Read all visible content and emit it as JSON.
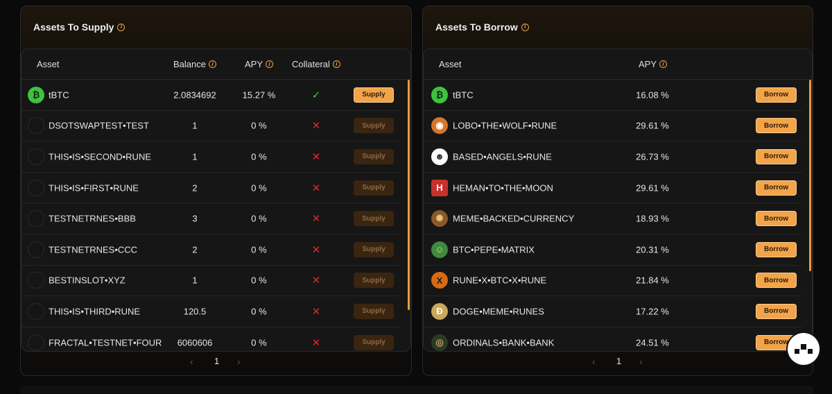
{
  "supply": {
    "title": "Assets To Supply",
    "headers": {
      "asset": "Asset",
      "balance": "Balance",
      "apy": "APY",
      "collateral": "Collateral"
    },
    "rows": [
      {
        "icon": "btc",
        "name": "tBTC",
        "balance": "2.0834692",
        "apy": "15.27 %",
        "collateral": "✓",
        "collateral_ok": true,
        "button": "Supply",
        "active": true
      },
      {
        "icon": "empty",
        "name": "DSOTSWAPTEST•TEST",
        "balance": "1",
        "apy": "0 %",
        "collateral": "✕",
        "collateral_ok": false,
        "button": "Supply",
        "active": false
      },
      {
        "icon": "empty",
        "name": "THIS•IS•SECOND•RUNE",
        "balance": "1",
        "apy": "0 %",
        "collateral": "✕",
        "collateral_ok": false,
        "button": "Supply",
        "active": false
      },
      {
        "icon": "empty",
        "name": "THIS•IS•FIRST•RUNE",
        "balance": "2",
        "apy": "0 %",
        "collateral": "✕",
        "collateral_ok": false,
        "button": "Supply",
        "active": false
      },
      {
        "icon": "empty",
        "name": "TESTNETRNES•BBB",
        "balance": "3",
        "apy": "0 %",
        "collateral": "✕",
        "collateral_ok": false,
        "button": "Supply",
        "active": false
      },
      {
        "icon": "empty",
        "name": "TESTNETRNES•CCC",
        "balance": "2",
        "apy": "0 %",
        "collateral": "✕",
        "collateral_ok": false,
        "button": "Supply",
        "active": false
      },
      {
        "icon": "empty",
        "name": "BESTINSLOT•XYZ",
        "balance": "1",
        "apy": "0 %",
        "collateral": "✕",
        "collateral_ok": false,
        "button": "Supply",
        "active": false
      },
      {
        "icon": "empty",
        "name": "THIS•IS•THIRD•RUNE",
        "balance": "120.5",
        "apy": "0 %",
        "collateral": "✕",
        "collateral_ok": false,
        "button": "Supply",
        "active": false
      },
      {
        "icon": "empty",
        "name": "FRACTAL•TESTNET•FOUR",
        "balance": "6060606",
        "apy": "0 %",
        "collateral": "✕",
        "collateral_ok": false,
        "button": "Supply",
        "active": false
      }
    ],
    "pager": {
      "prev": "‹",
      "page": "1",
      "next": "›"
    }
  },
  "borrow": {
    "title": "Assets To Borrow",
    "headers": {
      "asset": "Asset",
      "apy": "APY"
    },
    "rows": [
      {
        "icon": "btc",
        "glyph": "₿",
        "name": "tBTC",
        "apy": "16.08 %",
        "button": "Borrow"
      },
      {
        "icon": "s1",
        "glyph": "◉",
        "name": "LOBO•THE•WOLF•RUNE",
        "apy": "29.61 %",
        "button": "Borrow"
      },
      {
        "icon": "s2",
        "glyph": "☻",
        "name": "BASED•ANGELS•RUNE",
        "apy": "26.73 %",
        "button": "Borrow"
      },
      {
        "icon": "s3",
        "glyph": "H",
        "name": "HEMAN•TO•THE•MOON",
        "apy": "29.61 %",
        "button": "Borrow"
      },
      {
        "icon": "s4",
        "glyph": "✺",
        "name": "MEME•BACKED•CURRENCY",
        "apy": "18.93 %",
        "button": "Borrow"
      },
      {
        "icon": "s5",
        "glyph": "☺",
        "name": "BTC•PEPE•MATRIX",
        "apy": "20.31 %",
        "button": "Borrow"
      },
      {
        "icon": "s6",
        "glyph": "X",
        "name": "RUNE•X•BTC•X•RUNE",
        "apy": "21.84 %",
        "button": "Borrow"
      },
      {
        "icon": "s7",
        "glyph": "Ð",
        "name": "DOGE•MEME•RUNES",
        "apy": "17.22 %",
        "button": "Borrow"
      },
      {
        "icon": "s8",
        "glyph": "◎",
        "name": "ORDINALS•BANK•BANK",
        "apy": "24.51 %",
        "button": "Borrow"
      }
    ],
    "pager": {
      "prev": "‹",
      "page": "1",
      "next": "›"
    }
  },
  "colors": {
    "accent": "#f2a44b",
    "success": "#3fcf3f",
    "danger": "#e02828"
  }
}
